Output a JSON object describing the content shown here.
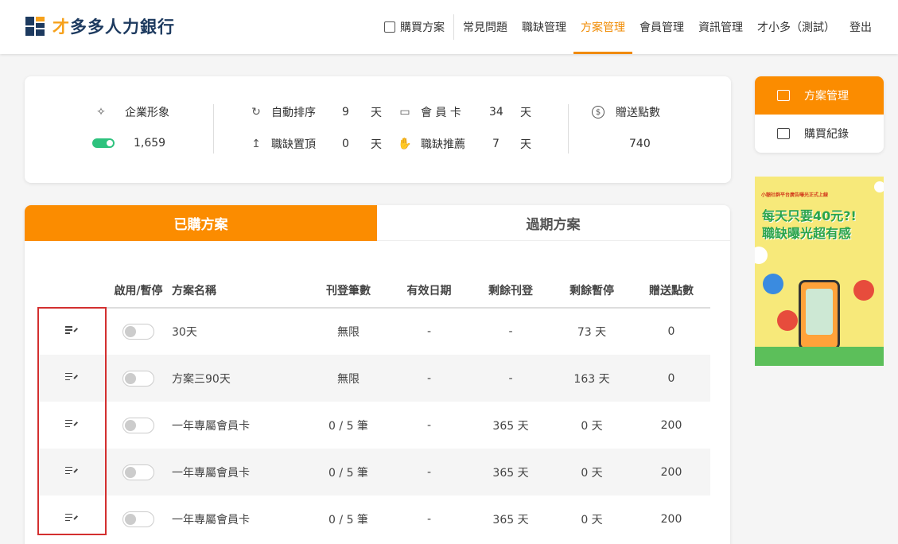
{
  "brand": {
    "logo_accent": "才",
    "logo_text": "多多人力銀行",
    "color": "#1d3a5f",
    "accent_color": "#f6a11b"
  },
  "nav": {
    "items": [
      {
        "label": "購買方案",
        "icon": "shopping-bag-icon"
      },
      {
        "label": "常見問題"
      },
      {
        "label": "職缺管理"
      },
      {
        "label": "方案管理",
        "active": true
      },
      {
        "label": "會員管理"
      },
      {
        "label": "資訊管理"
      },
      {
        "label": "才小多（測試）"
      },
      {
        "label": "登出"
      }
    ],
    "active_color": "#f08a00"
  },
  "stats": {
    "corporate_image": {
      "label": "企業形象",
      "value": "1,659",
      "icon": "sparkle-icon"
    },
    "auto_sort": {
      "label": "自動排序",
      "value": "9",
      "unit": "天",
      "icon": "refresh-icon"
    },
    "pin_top": {
      "label": "職缺置頂",
      "value": "0",
      "unit": "天",
      "icon": "arrow-up-icon"
    },
    "member_card": {
      "label": "會 員 卡",
      "value": "34",
      "unit": "天",
      "icon": "card-icon"
    },
    "recommend": {
      "label": "職缺推薦",
      "value": "7",
      "unit": "天",
      "icon": "hand-icon"
    },
    "bonus_points": {
      "label": "贈送點數",
      "value": "740",
      "icon": "dollar-icon"
    }
  },
  "side_menu": {
    "items": [
      {
        "label": "方案管理",
        "icon": "wallet-icon",
        "active": true
      },
      {
        "label": "購買紀錄",
        "icon": "history-bag-icon"
      }
    ]
  },
  "banner": {
    "top_text": "小額社群平台廣告曝光正式上線",
    "line1": "每天只要40元?!",
    "line2": "職缺曝光超有感"
  },
  "tabs": [
    {
      "label": "已購方案",
      "active": true
    },
    {
      "label": "過期方案"
    }
  ],
  "table": {
    "headers": [
      "",
      "啟用/暫停",
      "方案名稱",
      "刊登筆數",
      "有效日期",
      "剩餘刊登",
      "剩餘暫停",
      "贈送點數"
    ],
    "rows": [
      {
        "name": "30天",
        "postings": "無限",
        "valid": "-",
        "remain_post": "-",
        "remain_pause": "73 天",
        "points": "0"
      },
      {
        "name": "方案三90天",
        "postings": "無限",
        "valid": "-",
        "remain_post": "-",
        "remain_pause": "163 天",
        "points": "0"
      },
      {
        "name": "一年專屬會員卡",
        "postings": "0 / 5 筆",
        "valid": "-",
        "remain_post": "365 天",
        "remain_pause": "0 天",
        "points": "200"
      },
      {
        "name": "一年專屬會員卡",
        "postings": "0 / 5 筆",
        "valid": "-",
        "remain_post": "365 天",
        "remain_pause": "0 天",
        "points": "200"
      },
      {
        "name": "一年專屬會員卡",
        "postings": "0 / 5 筆",
        "valid": "-",
        "remain_post": "365 天",
        "remain_pause": "0 天",
        "points": "200"
      }
    ]
  },
  "colors": {
    "primary": "#fb8c00",
    "toggle_on": "#2ec27e",
    "highlight": "#d32f2f"
  }
}
